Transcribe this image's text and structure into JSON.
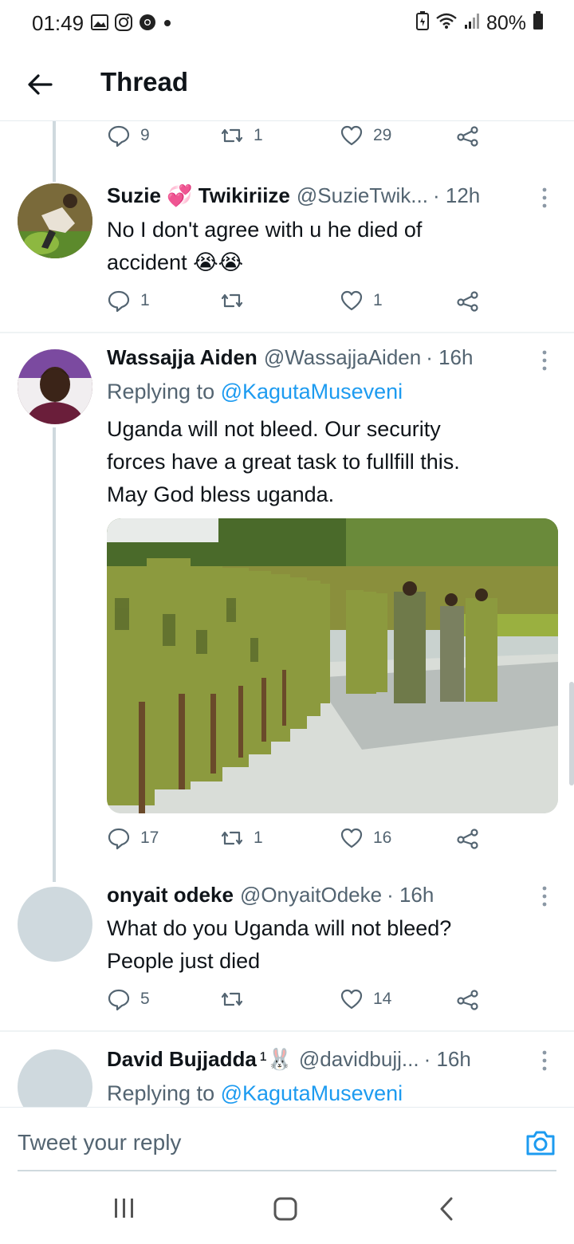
{
  "status_bar": {
    "time": "01:49",
    "battery": "80%"
  },
  "header": {
    "title": "Thread"
  },
  "tweets": [
    {
      "actions": {
        "replies": "9",
        "retweets": "1",
        "likes": "29"
      }
    },
    {
      "name_first": "Suzie",
      "name_emoji": "💞",
      "name_last": "Twikiriize",
      "handle": "@SuzieTwik...",
      "time": "· 12h",
      "text_line1": "No I don't agree with u he died of",
      "text_line2": "accident 😭😭",
      "actions": {
        "replies": "1",
        "retweets": "",
        "likes": "1"
      }
    },
    {
      "name": "Wassajja Aiden",
      "handle": "@WassajjaAiden",
      "time": "· 16h",
      "replying_prefix": "Replying to",
      "replying_mention": "@KagutaMuseveni",
      "text_line1": "Uganda will not bleed. Our security",
      "text_line2": "forces have a great task to fullfill this.",
      "text_line3": "May God bless uganda.",
      "actions": {
        "replies": "17",
        "retweets": "1",
        "likes": "16"
      }
    },
    {
      "name": "onyait odeke",
      "handle": "@OnyaitOdeke",
      "time": "· 16h",
      "text_line1": "What do you Uganda will not bleed?",
      "text_line2": "People just died",
      "actions": {
        "replies": "5",
        "retweets": "",
        "likes": "14"
      }
    },
    {
      "name": "David Bujjadda",
      "name_suffix": "¹🐰",
      "handle": "@davidbujj...",
      "time": "· 16h",
      "replying_prefix": "Replying to",
      "replying_mention": "@KagutaMuseveni"
    }
  ],
  "compose": {
    "placeholder": "Tweet your reply"
  },
  "colors": {
    "accent": "#1d9bf0",
    "secondary_text": "#536471",
    "divider": "#eff3f4"
  }
}
